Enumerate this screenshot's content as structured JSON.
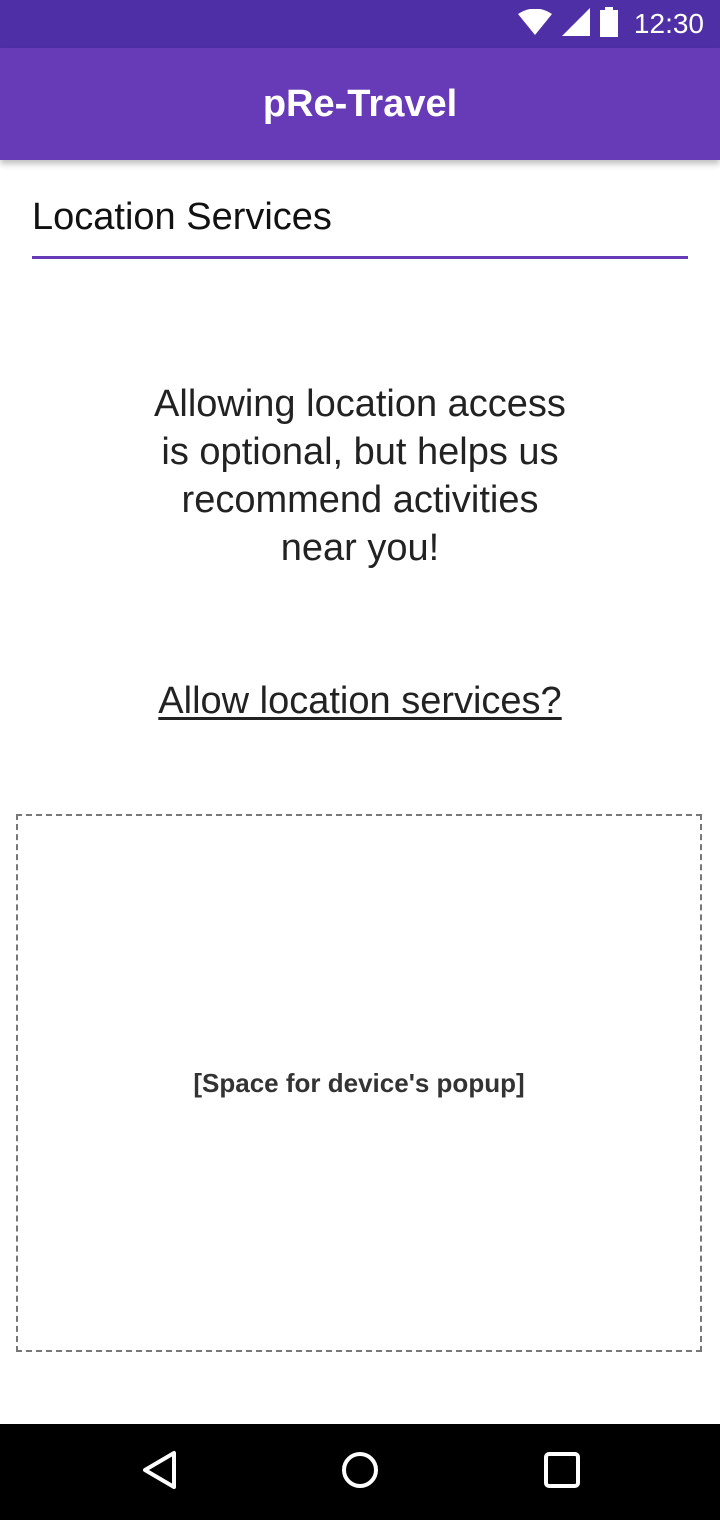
{
  "status_bar": {
    "time": "12:30",
    "icons": [
      "wifi-icon",
      "signal-icon",
      "battery-icon"
    ],
    "background": "#4f2fa6"
  },
  "app_bar": {
    "title": "pRe-Travel",
    "background": "#673ab7"
  },
  "section": {
    "title": "Location Services",
    "accent": "#673ab7"
  },
  "message": {
    "text": "Allowing location access is optional, but helps us recommend activities near you!"
  },
  "link": {
    "label": "Allow location services?"
  },
  "popup_space": {
    "label": "[Space for device's popup]"
  },
  "nav_bar": {
    "buttons": [
      "back-icon",
      "home-icon",
      "recents-icon"
    ]
  }
}
